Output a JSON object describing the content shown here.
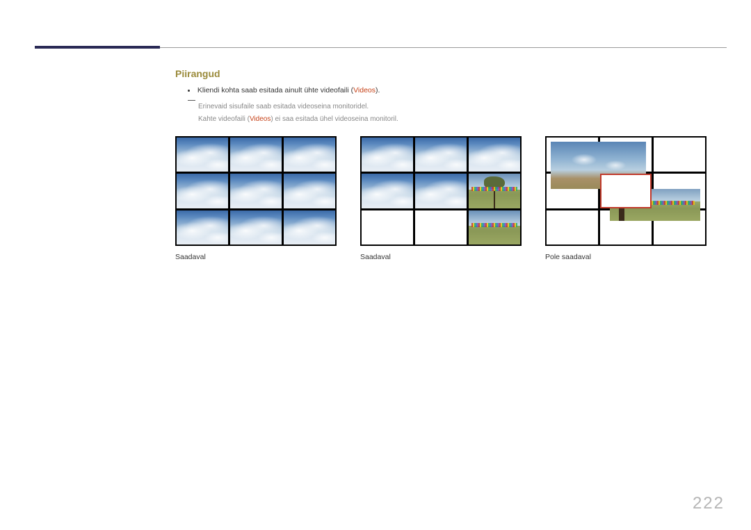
{
  "section_title": "Piirangud",
  "bullet": {
    "prefix": "Kliendi kohta saab esitada ainult ühte videofaili (",
    "em": "Videos",
    "suffix": ")."
  },
  "note1": "Erinevaid sisufaile saab esitada videoseina monitoridel.",
  "note2": {
    "prefix": "Kahte videofaili (",
    "em": "Videos",
    "suffix": ") ei saa esitada ühel videoseina monitoril."
  },
  "captions": {
    "fig1": "Saadaval",
    "fig2": "Saadaval",
    "fig3": "Pole saadaval"
  },
  "page_number": "222"
}
